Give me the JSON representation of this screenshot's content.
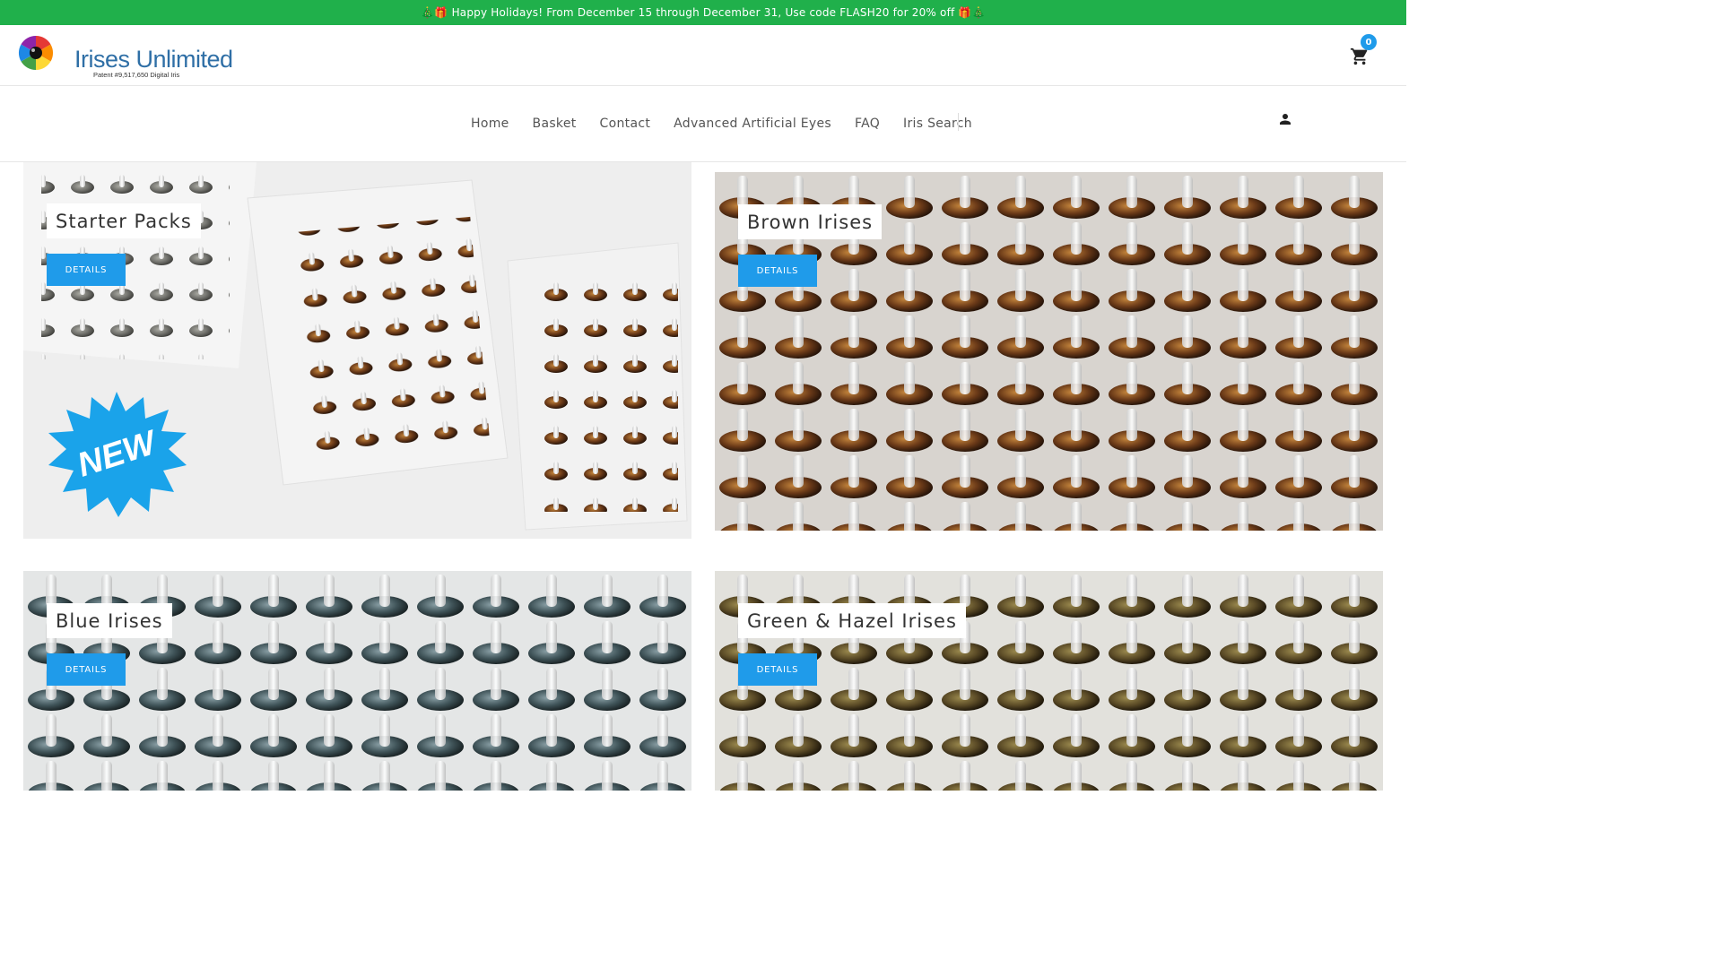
{
  "promo": {
    "text": "🎄🎁 Happy Holidays! From December 15 through December 31, Use code FLASH20 for 20% off 🎁🎄"
  },
  "brand": {
    "name": "Irises Unlimited",
    "patent": "Patent #9,517,650 Digital Iris"
  },
  "cart": {
    "count": "0",
    "icon": "cart-icon"
  },
  "nav": {
    "items": [
      "Home",
      "Basket",
      "Contact",
      "Advanced Artificial Eyes",
      "FAQ",
      "Iris Search"
    ],
    "account_icon": "user-icon"
  },
  "tiles": [
    {
      "title": "Starter Packs",
      "button": "DETAILS",
      "badge": "NEW"
    },
    {
      "title": "Brown Irises",
      "button": "DETAILS"
    },
    {
      "title": "Blue Irises",
      "button": "DETAILS"
    },
    {
      "title": "Green & Hazel Irises",
      "button": "DETAILS"
    }
  ],
  "colors": {
    "promo": "#20b04b",
    "accent": "#1f9bea",
    "logo": "#2f6fa6"
  }
}
